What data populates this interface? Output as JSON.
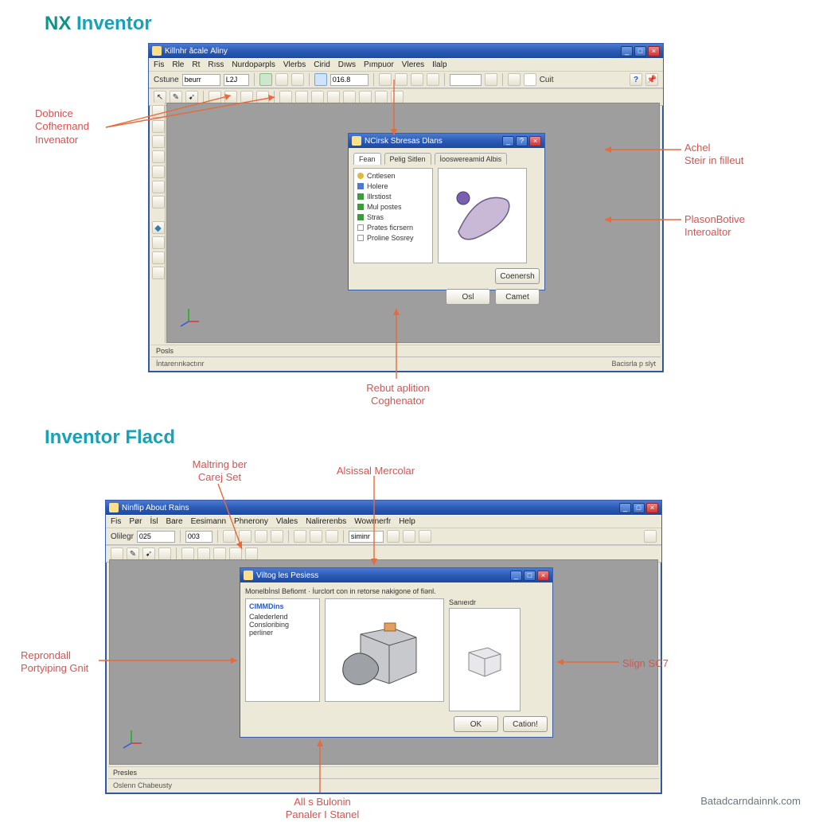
{
  "headings": {
    "top": "NX Inventor",
    "top_emph": "NX",
    "bottom": "Inventor Flacd"
  },
  "callouts": {
    "dobnice": "Dobnice\nCofhernand\nInvenator",
    "achel": "Achel\nSteir in filleut",
    "plason": "PlasonBotive\nInteroaltor",
    "rebut": "Rebut aplition\nCoghenator",
    "maltr": "Maltring ber\nCarej Set",
    "alsissal": "Alsissal Mercolar",
    "reprond": "Reprondall\nPortyiping Gnit",
    "slign": "Slign SC7",
    "alls": "All s Bulonin\nPanaler I Stanel"
  },
  "footer": "Batadcarndainnk.com",
  "win1": {
    "title": "Killnhr ǎcale Áliny",
    "menu": [
      "Fis",
      "Rle",
      "Rt",
      "Rıss",
      "Nurdopərpls",
      "Vlerbs",
      "Cirid",
      "Dıws",
      "Pımpuor",
      "Vleres",
      "Ilalp"
    ],
    "toolbar1": {
      "label": "Cstune",
      "input1": "beurr",
      "input2": "L2J",
      "input3": "016.8",
      "endlabel": "Cuit"
    },
    "status_l": "Posls",
    "status_r": "İntarerınkəctınr",
    "status_rr": "Bacisrla p slyt"
  },
  "dialog1": {
    "title": "NCirsk Sbresas Dlans",
    "tabs": [
      "Fean",
      "Pelig Sitlen",
      "İooswereamid Albis"
    ],
    "items": [
      "Cntlesen",
      "Holere",
      "Illrstiost",
      "Mul postes",
      "Stras",
      "Prətes ficrsern",
      "Proline Sosrey"
    ],
    "btn_c": "Coenersh",
    "btn_ok": "Osl",
    "btn_cancel": "Camet"
  },
  "win2": {
    "title": "Ninflip About Rains",
    "menu": [
      "Fis",
      "Pør",
      "İsl",
      "Bare",
      "Eesimann",
      "Phnerony",
      "Vlales",
      "Nalirerenbs",
      "Wowrnerfr",
      "Help"
    ],
    "toolbar1": {
      "label": "Olilegr",
      "input1": "025",
      "input2": "003",
      "input3": "siminr"
    },
    "status_l": "Oslenn Chabeusty",
    "prompt": "Presles"
  },
  "dialog2": {
    "title": "Viltog les Pesiess",
    "desc": "Monelbİnsl Befiomt · İurclort con in retorse nakigone of fiənl.",
    "sidebar_h": "CIMMDins",
    "items": [
      "Calederlend",
      "Consloribing",
      "perliner"
    ],
    "section_r": "Sanıeıdr",
    "btn_ok": "OK",
    "btn_cancel": "Cation!"
  }
}
